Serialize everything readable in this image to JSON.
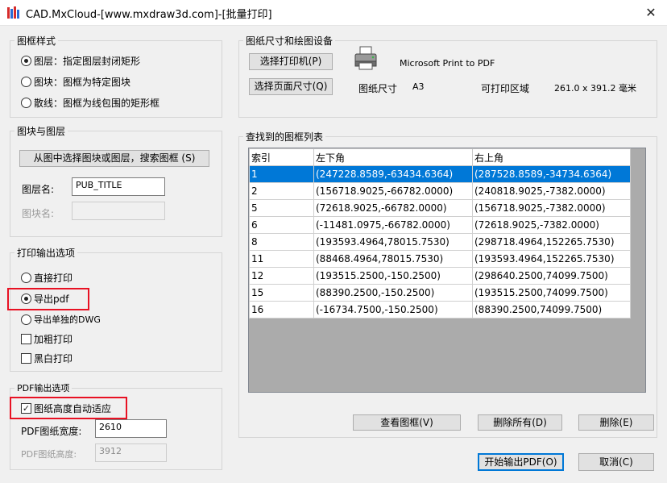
{
  "window": {
    "title": "CAD.MxCloud-[www.mxdraw3d.com]-[批量打印]",
    "close_glyph": "✕"
  },
  "frame_style": {
    "title": "图框样式",
    "options": [
      {
        "label": "图层：指定图层封闭矩形",
        "selected": true
      },
      {
        "label": "图块：图框为特定图块",
        "selected": false
      },
      {
        "label": "散线：图框为线包围的矩形框",
        "selected": false
      }
    ]
  },
  "block_layer": {
    "title": "图块与图层",
    "select_button": "从图中选择图块或图层，搜索图框 (S)",
    "layer_label": "图层名:",
    "layer_value": "PUB_TITLE",
    "block_label": "图块名:",
    "block_value": ""
  },
  "print_output": {
    "title": "打印输出选项",
    "radios": [
      {
        "label": "直接打印",
        "selected": false
      },
      {
        "label": "导出pdf",
        "selected": true
      },
      {
        "label": "导出单独的DWG",
        "selected": false
      }
    ],
    "checks": [
      {
        "label": "加粗打印",
        "checked": false
      },
      {
        "label": "黑白打印",
        "checked": false
      }
    ]
  },
  "pdf_output": {
    "title": "PDF输出选项",
    "auto_height_label": "图纸高度自动适应",
    "auto_height_checked": true,
    "check_glyph": "✓",
    "width_label": "PDF图纸宽度:",
    "width_value": "2610",
    "height_label": "PDF图纸高度:",
    "height_value": "3912"
  },
  "paper_device": {
    "title": "图纸尺寸和绘图设备",
    "select_printer_button": "选择打印机(P)",
    "printer_name": "Microsoft Print to PDF",
    "select_page_button": "选择页面尺寸(Q)",
    "paper_size_label": "图纸尺寸",
    "paper_size_value": "A3",
    "printable_label": "可打印区域",
    "printable_value": "261.0 x 391.2 毫米"
  },
  "frame_list": {
    "title": "查找到的图框列表",
    "columns": [
      "索引",
      "左下角",
      "右上角"
    ],
    "rows": [
      {
        "index": "1",
        "lower_left": "(247228.8589,-63434.6364)",
        "upper_right": "(287528.8589,-34734.6364)",
        "selected": true
      },
      {
        "index": "2",
        "lower_left": "(156718.9025,-66782.0000)",
        "upper_right": "(240818.9025,-7382.0000)",
        "selected": false
      },
      {
        "index": "5",
        "lower_left": "(72618.9025,-66782.0000)",
        "upper_right": "(156718.9025,-7382.0000)",
        "selected": false
      },
      {
        "index": "6",
        "lower_left": "(-11481.0975,-66782.0000)",
        "upper_right": "(72618.9025,-7382.0000)",
        "selected": false
      },
      {
        "index": "8",
        "lower_left": "(193593.4964,78015.7530)",
        "upper_right": "(298718.4964,152265.7530)",
        "selected": false
      },
      {
        "index": "11",
        "lower_left": "(88468.4964,78015.7530)",
        "upper_right": "(193593.4964,152265.7530)",
        "selected": false
      },
      {
        "index": "12",
        "lower_left": "(193515.2500,-150.2500)",
        "upper_right": "(298640.2500,74099.7500)",
        "selected": false
      },
      {
        "index": "15",
        "lower_left": "(88390.2500,-150.2500)",
        "upper_right": "(193515.2500,74099.7500)",
        "selected": false
      },
      {
        "index": "16",
        "lower_left": "(-16734.7500,-150.2500)",
        "upper_right": "(88390.2500,74099.7500)",
        "selected": false
      }
    ],
    "view_button": "查看图框(V)",
    "delete_all_button": "删除所有(D)",
    "delete_button": "删除(E)"
  },
  "footer": {
    "start_button": "开始输出PDF(O)",
    "cancel_button": "取消(C)"
  },
  "colors": {
    "selection": "#0078d7",
    "highlight": "#e81123",
    "table_empty": "#ababab"
  },
  "icons": {
    "app": "cad-app-icon",
    "printer": "printer-icon"
  }
}
